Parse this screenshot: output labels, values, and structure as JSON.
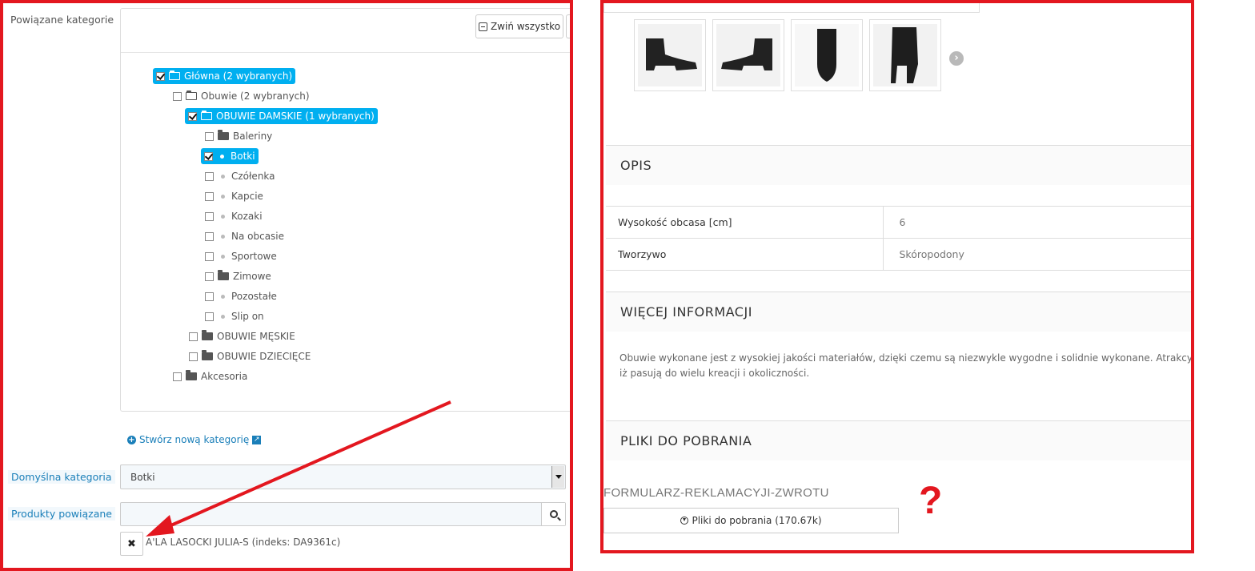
{
  "left": {
    "label_related_categories": "Powiązane kategorie",
    "collapse_all": "Zwiń wszystko",
    "tree": [
      {
        "label": "Główna (2 wybranych)",
        "checked": true,
        "highlight": true,
        "icon": "folder-open-icon"
      },
      {
        "label": "Obuwie (2 wybranych)",
        "checked": false,
        "highlight": false,
        "icon": "folder-open-icon"
      },
      {
        "label": "OBUWIE DAMSKIE (1 wybranych)",
        "checked": true,
        "highlight": true,
        "icon": "folder-open-icon"
      },
      {
        "label": "Baleriny",
        "checked": false,
        "highlight": false,
        "icon": "folder-icon"
      },
      {
        "label": "Botki",
        "checked": true,
        "highlight": true,
        "icon": "bullet-icon"
      },
      {
        "label": "Czółenka",
        "checked": false,
        "highlight": false,
        "icon": "bullet-icon"
      },
      {
        "label": "Kapcie",
        "checked": false,
        "highlight": false,
        "icon": "bullet-icon"
      },
      {
        "label": "Kozaki",
        "checked": false,
        "highlight": false,
        "icon": "bullet-icon"
      },
      {
        "label": "Na obcasie",
        "checked": false,
        "highlight": false,
        "icon": "bullet-icon"
      },
      {
        "label": "Sportowe",
        "checked": false,
        "highlight": false,
        "icon": "bullet-icon"
      },
      {
        "label": "Zimowe",
        "checked": false,
        "highlight": false,
        "icon": "folder-icon"
      },
      {
        "label": "Pozostałe",
        "checked": false,
        "highlight": false,
        "icon": "bullet-icon"
      },
      {
        "label": "Slip on",
        "checked": false,
        "highlight": false,
        "icon": "bullet-icon"
      },
      {
        "label": "OBUWIE MĘSKIE",
        "checked": false,
        "highlight": false,
        "icon": "folder-icon"
      },
      {
        "label": "OBUWIE DZIECIĘCE",
        "checked": false,
        "highlight": false,
        "icon": "folder-icon"
      },
      {
        "label": "Akcesoria",
        "checked": false,
        "highlight": false,
        "icon": "folder-icon"
      }
    ],
    "create_category": "Stwórz nową kategorię",
    "label_default_category": "Domyślna kategoria",
    "default_category_value": "Botki",
    "label_related_products": "Produkty powiązane",
    "related_product": "A'LA LASOCKI JULIA-S (indeks: DA9361c)",
    "accent_color": "#00aff0",
    "annotation_color": "#e3171f"
  },
  "right": {
    "section_opis": "OPIS",
    "specs": [
      {
        "key": "Wysokość obcasa [cm]",
        "value": "6"
      },
      {
        "key": "Tworzywo",
        "value": "Skóropodony"
      }
    ],
    "section_more_info": "WIĘCEJ INFORMACJI",
    "description_line1": "Obuwie wykonane jest z wysokiej jakości materiałów, dzięki czemu są niezwykle wygodne i solidnie wykonane. Atrakcyjny w",
    "description_line2": "iż pasują do wielu kreacji i okoliczności.",
    "section_downloads": "PLIKI DO POBRANIA",
    "file_name": "FORMULARZ-REKLAMACYJI-ZWROTU",
    "download_button": "Pliki do pobrania (170.67k)",
    "annotation_mark": "?"
  }
}
